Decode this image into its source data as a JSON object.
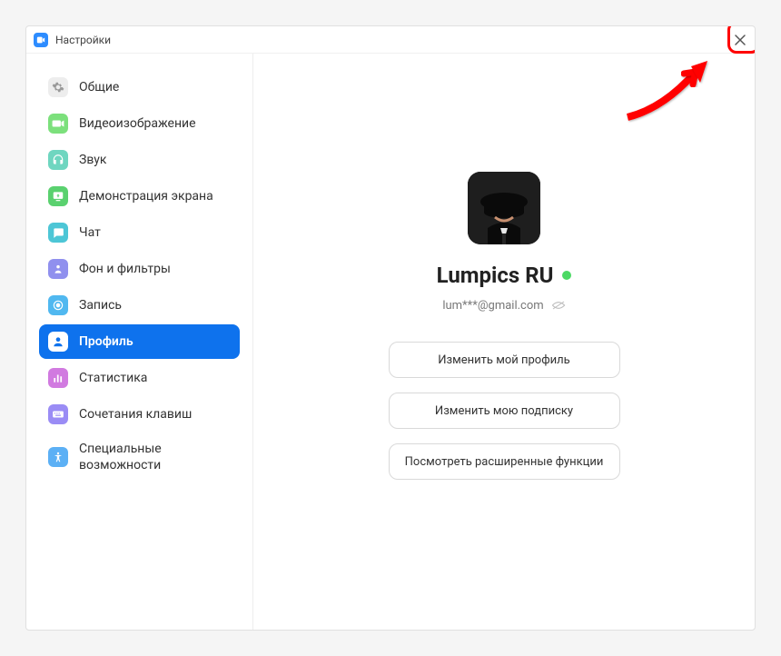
{
  "window": {
    "title": "Настройки"
  },
  "sidebar": {
    "items": [
      {
        "key": "general",
        "label": "Общие"
      },
      {
        "key": "video",
        "label": "Видеоизображение"
      },
      {
        "key": "audio",
        "label": "Звук"
      },
      {
        "key": "share",
        "label": "Демонстрация экрана"
      },
      {
        "key": "chat",
        "label": "Чат"
      },
      {
        "key": "background",
        "label": "Фон и фильтры"
      },
      {
        "key": "recording",
        "label": "Запись"
      },
      {
        "key": "profile",
        "label": "Профиль",
        "active": true
      },
      {
        "key": "statistics",
        "label": "Статистика"
      },
      {
        "key": "shortcuts",
        "label": "Сочетания клавиш"
      },
      {
        "key": "accessibility",
        "label": "Специальные возможности"
      }
    ]
  },
  "profile": {
    "display_name": "Lumpics RU",
    "email_masked": "lum***@gmail.com",
    "presence_color": "#4cd964",
    "buttons": {
      "edit_profile": "Изменить мой профиль",
      "change_subscription": "Изменить мою подписку",
      "view_advanced": "Посмотреть расширенные функции"
    }
  },
  "annotation": {
    "highlight_color": "#ff0000"
  }
}
